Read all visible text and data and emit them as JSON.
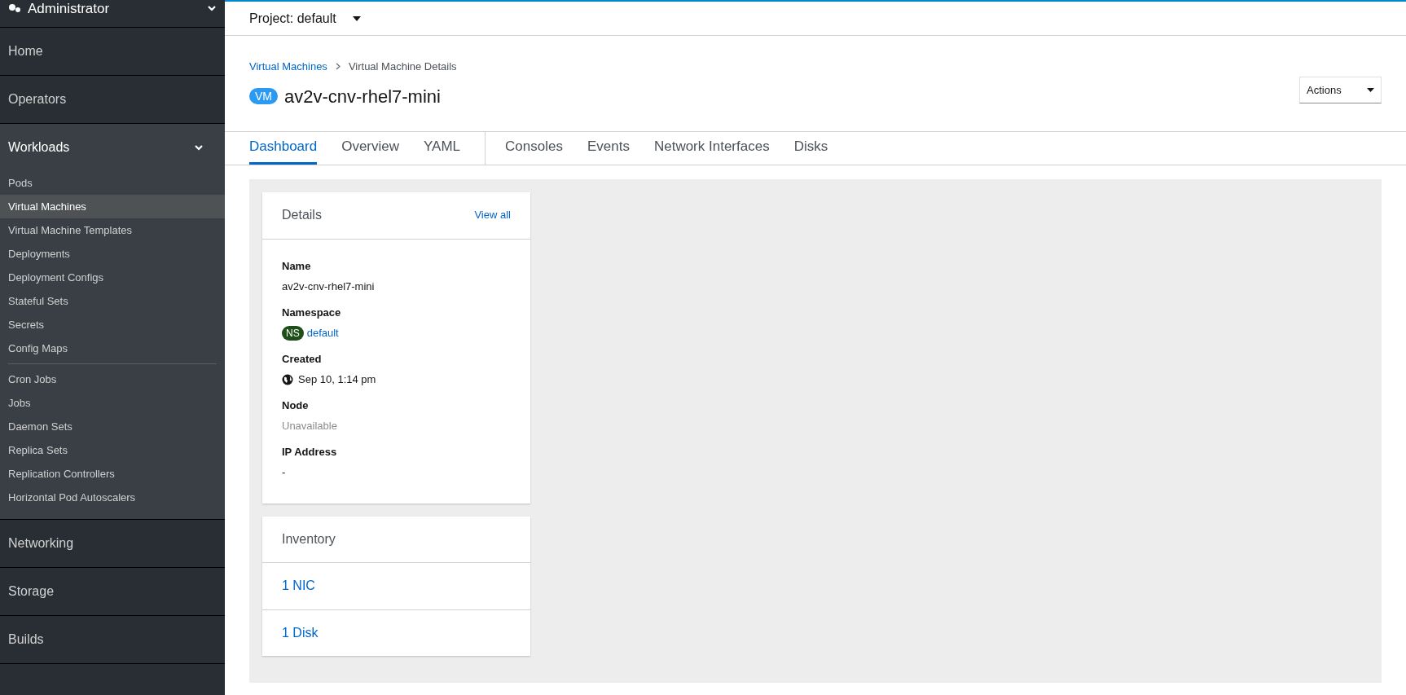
{
  "sidebar": {
    "perspective": "Administrator",
    "sections": [
      {
        "label": "Home"
      },
      {
        "label": "Operators"
      },
      {
        "label": "Workloads",
        "expanded": true,
        "groups": [
          [
            {
              "label": "Pods",
              "selected": false
            },
            {
              "label": "Virtual Machines",
              "selected": true
            },
            {
              "label": "Virtual Machine Templates",
              "selected": false
            },
            {
              "label": "Deployments",
              "selected": false
            },
            {
              "label": "Deployment Configs",
              "selected": false
            },
            {
              "label": "Stateful Sets",
              "selected": false
            },
            {
              "label": "Secrets",
              "selected": false
            },
            {
              "label": "Config Maps",
              "selected": false
            }
          ],
          [
            {
              "label": "Cron Jobs",
              "selected": false
            },
            {
              "label": "Jobs",
              "selected": false
            },
            {
              "label": "Daemon Sets",
              "selected": false
            },
            {
              "label": "Replica Sets",
              "selected": false
            },
            {
              "label": "Replication Controllers",
              "selected": false
            },
            {
              "label": "Horizontal Pod Autoscalers",
              "selected": false
            }
          ]
        ]
      },
      {
        "label": "Networking"
      },
      {
        "label": "Storage"
      },
      {
        "label": "Builds"
      }
    ]
  },
  "project": "Project: default",
  "breadcrumb": [
    {
      "label": "Virtual Machines"
    },
    {
      "label": "Virtual Machine Details"
    }
  ],
  "title": {
    "badge": "VM",
    "name": "av2v-cnv-rhel7-mini"
  },
  "actions": "Actions",
  "tabs": [
    {
      "label": "Dashboard",
      "selected": true
    },
    {
      "label": "Overview",
      "selected": false
    },
    {
      "label": "YAML",
      "selected": false
    },
    {
      "label": "Consoles",
      "selected": false
    },
    {
      "label": "Events",
      "selected": false
    },
    {
      "label": "Network Interfaces",
      "selected": false
    },
    {
      "label": "Disks",
      "selected": false
    }
  ],
  "details": {
    "title": "Details",
    "link": "View all",
    "fields": [
      {
        "kind": "text",
        "label": "Name",
        "value": "av2v-cnv-rhel7-mini"
      },
      {
        "kind": "namespace",
        "label": "Namespace",
        "badge": "NS",
        "value": "default"
      },
      {
        "kind": "time",
        "label": "Created",
        "value": "Sep 10, 1:14 pm"
      },
      {
        "kind": "muted",
        "label": "Node",
        "value": "Unavailable"
      },
      {
        "kind": "text",
        "label": "IP Address",
        "value": "-"
      }
    ]
  },
  "inventory": {
    "title": "Inventory",
    "items": [
      "1 NIC",
      "1 Disk"
    ]
  }
}
